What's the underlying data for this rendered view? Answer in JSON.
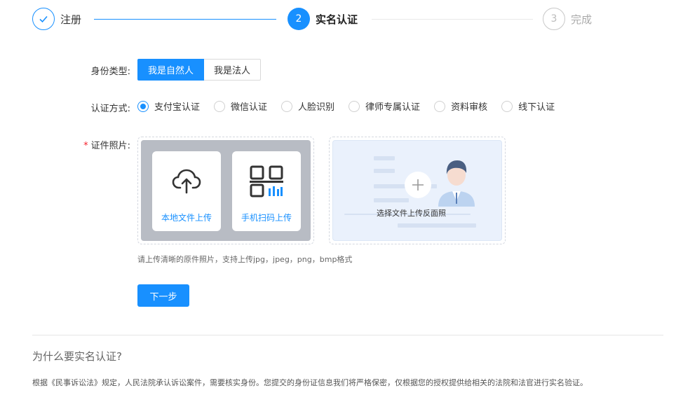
{
  "steps": [
    {
      "number": "",
      "label": "注册",
      "state": "done"
    },
    {
      "number": "2",
      "label": "实名认证",
      "state": "active"
    },
    {
      "number": "3",
      "label": "完成",
      "state": "pending"
    }
  ],
  "identity": {
    "label": "身份类型:",
    "options": [
      "我是自然人",
      "我是法人"
    ],
    "selected": "我是自然人"
  },
  "auth_method": {
    "label": "认证方式:",
    "options": [
      "支付宝认证",
      "微信认证",
      "人脸识别",
      "律师专属认证",
      "资料审核",
      "线下认证"
    ],
    "selected": "支付宝认证"
  },
  "photo": {
    "required_mark": "*",
    "label": "证件照片:",
    "local_upload": "本地文件上传",
    "scan_upload": "手机扫码上传",
    "back_upload": "选择文件上传反面照",
    "hint": "请上传清晰的原件照片，支持上传jpg，jpeg，png，bmp格式"
  },
  "next_button": "下一步",
  "faq": {
    "title": "为什么要实名认证?",
    "description": "根据《民事诉讼法》规定，人民法院承认诉讼案件，需要核实身份。您提交的身份证信息我们将严格保密，仅根据您的授权提供给相关的法院和法官进行实名验证。"
  },
  "colors": {
    "accent": "#1890ff"
  }
}
